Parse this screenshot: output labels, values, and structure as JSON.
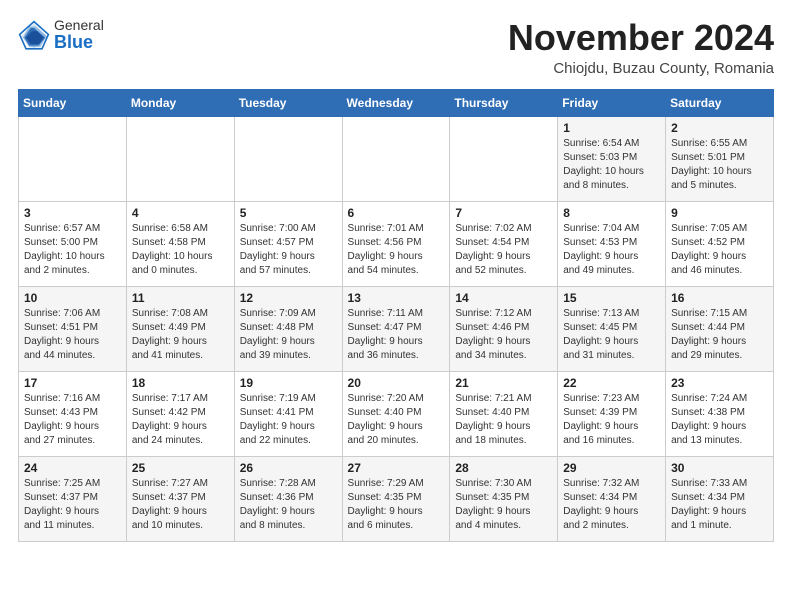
{
  "logo": {
    "general": "General",
    "blue": "Blue"
  },
  "header": {
    "month": "November 2024",
    "location": "Chiojdu, Buzau County, Romania"
  },
  "weekdays": [
    "Sunday",
    "Monday",
    "Tuesday",
    "Wednesday",
    "Thursday",
    "Friday",
    "Saturday"
  ],
  "weeks": [
    [
      {
        "day": "",
        "info": ""
      },
      {
        "day": "",
        "info": ""
      },
      {
        "day": "",
        "info": ""
      },
      {
        "day": "",
        "info": ""
      },
      {
        "day": "",
        "info": ""
      },
      {
        "day": "1",
        "info": "Sunrise: 6:54 AM\nSunset: 5:03 PM\nDaylight: 10 hours\nand 8 minutes."
      },
      {
        "day": "2",
        "info": "Sunrise: 6:55 AM\nSunset: 5:01 PM\nDaylight: 10 hours\nand 5 minutes."
      }
    ],
    [
      {
        "day": "3",
        "info": "Sunrise: 6:57 AM\nSunset: 5:00 PM\nDaylight: 10 hours\nand 2 minutes."
      },
      {
        "day": "4",
        "info": "Sunrise: 6:58 AM\nSunset: 4:58 PM\nDaylight: 10 hours\nand 0 minutes."
      },
      {
        "day": "5",
        "info": "Sunrise: 7:00 AM\nSunset: 4:57 PM\nDaylight: 9 hours\nand 57 minutes."
      },
      {
        "day": "6",
        "info": "Sunrise: 7:01 AM\nSunset: 4:56 PM\nDaylight: 9 hours\nand 54 minutes."
      },
      {
        "day": "7",
        "info": "Sunrise: 7:02 AM\nSunset: 4:54 PM\nDaylight: 9 hours\nand 52 minutes."
      },
      {
        "day": "8",
        "info": "Sunrise: 7:04 AM\nSunset: 4:53 PM\nDaylight: 9 hours\nand 49 minutes."
      },
      {
        "day": "9",
        "info": "Sunrise: 7:05 AM\nSunset: 4:52 PM\nDaylight: 9 hours\nand 46 minutes."
      }
    ],
    [
      {
        "day": "10",
        "info": "Sunrise: 7:06 AM\nSunset: 4:51 PM\nDaylight: 9 hours\nand 44 minutes."
      },
      {
        "day": "11",
        "info": "Sunrise: 7:08 AM\nSunset: 4:49 PM\nDaylight: 9 hours\nand 41 minutes."
      },
      {
        "day": "12",
        "info": "Sunrise: 7:09 AM\nSunset: 4:48 PM\nDaylight: 9 hours\nand 39 minutes."
      },
      {
        "day": "13",
        "info": "Sunrise: 7:11 AM\nSunset: 4:47 PM\nDaylight: 9 hours\nand 36 minutes."
      },
      {
        "day": "14",
        "info": "Sunrise: 7:12 AM\nSunset: 4:46 PM\nDaylight: 9 hours\nand 34 minutes."
      },
      {
        "day": "15",
        "info": "Sunrise: 7:13 AM\nSunset: 4:45 PM\nDaylight: 9 hours\nand 31 minutes."
      },
      {
        "day": "16",
        "info": "Sunrise: 7:15 AM\nSunset: 4:44 PM\nDaylight: 9 hours\nand 29 minutes."
      }
    ],
    [
      {
        "day": "17",
        "info": "Sunrise: 7:16 AM\nSunset: 4:43 PM\nDaylight: 9 hours\nand 27 minutes."
      },
      {
        "day": "18",
        "info": "Sunrise: 7:17 AM\nSunset: 4:42 PM\nDaylight: 9 hours\nand 24 minutes."
      },
      {
        "day": "19",
        "info": "Sunrise: 7:19 AM\nSunset: 4:41 PM\nDaylight: 9 hours\nand 22 minutes."
      },
      {
        "day": "20",
        "info": "Sunrise: 7:20 AM\nSunset: 4:40 PM\nDaylight: 9 hours\nand 20 minutes."
      },
      {
        "day": "21",
        "info": "Sunrise: 7:21 AM\nSunset: 4:40 PM\nDaylight: 9 hours\nand 18 minutes."
      },
      {
        "day": "22",
        "info": "Sunrise: 7:23 AM\nSunset: 4:39 PM\nDaylight: 9 hours\nand 16 minutes."
      },
      {
        "day": "23",
        "info": "Sunrise: 7:24 AM\nSunset: 4:38 PM\nDaylight: 9 hours\nand 13 minutes."
      }
    ],
    [
      {
        "day": "24",
        "info": "Sunrise: 7:25 AM\nSunset: 4:37 PM\nDaylight: 9 hours\nand 11 minutes."
      },
      {
        "day": "25",
        "info": "Sunrise: 7:27 AM\nSunset: 4:37 PM\nDaylight: 9 hours\nand 10 minutes."
      },
      {
        "day": "26",
        "info": "Sunrise: 7:28 AM\nSunset: 4:36 PM\nDaylight: 9 hours\nand 8 minutes."
      },
      {
        "day": "27",
        "info": "Sunrise: 7:29 AM\nSunset: 4:35 PM\nDaylight: 9 hours\nand 6 minutes."
      },
      {
        "day": "28",
        "info": "Sunrise: 7:30 AM\nSunset: 4:35 PM\nDaylight: 9 hours\nand 4 minutes."
      },
      {
        "day": "29",
        "info": "Sunrise: 7:32 AM\nSunset: 4:34 PM\nDaylight: 9 hours\nand 2 minutes."
      },
      {
        "day": "30",
        "info": "Sunrise: 7:33 AM\nSunset: 4:34 PM\nDaylight: 9 hours\nand 1 minute."
      }
    ]
  ]
}
